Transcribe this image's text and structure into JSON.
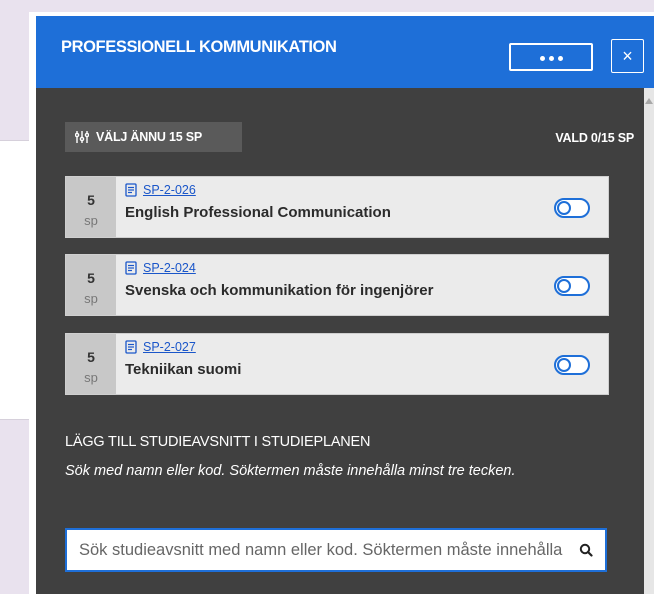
{
  "header": {
    "title": "PROFESSIONELL KOMMUNIKATION",
    "more_label": "more-options",
    "close_label": "×"
  },
  "summary": {
    "choose_label": "VÄLJ ÄNNU 15 SP",
    "selected_label": "VALD 0/15 SP"
  },
  "courses": [
    {
      "credits": "5",
      "unit": "sp",
      "code": "SP-2-026",
      "name": "English Professional Communication",
      "selected": false
    },
    {
      "credits": "5",
      "unit": "sp",
      "code": "SP-2-024",
      "name": "Svenska och kommunikation för ingenjörer",
      "selected": false
    },
    {
      "credits": "5",
      "unit": "sp",
      "code": "SP-2-027",
      "name": "Tekniikan suomi",
      "selected": false
    }
  ],
  "add_section": {
    "title": "LÄGG TILL STUDIEAVSNITT I STUDIEPLANEN",
    "hint": "Sök med namn eller kod. Söktermen måste innehålla minst tre tecken.",
    "search_placeholder": "Sök studieavsnitt med namn eller kod. Söktermen måste innehålla minst tre tecken.",
    "search_value": ""
  },
  "colors": {
    "header": "#1e6fd8",
    "panel_body": "#404040",
    "link": "#1a56c9",
    "toggle": "#1e6fd8"
  },
  "icons": [
    "filter-icon",
    "document-icon",
    "search-icon",
    "close-icon",
    "more-icon"
  ]
}
